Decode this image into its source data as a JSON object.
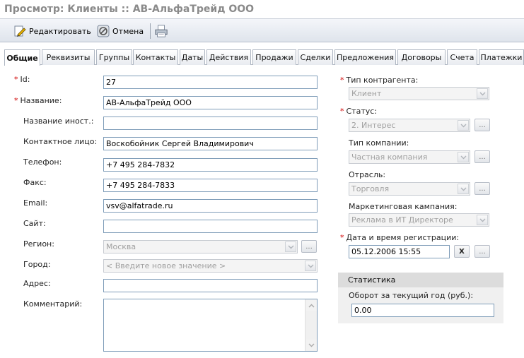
{
  "window": {
    "title": "Просмотр: Клиенты :: АВ-АльфаТрейд ООО"
  },
  "toolbar": {
    "edit_label": "Редактировать",
    "cancel_label": "Отмена"
  },
  "tabs": [
    "Общие",
    "Реквизиты",
    "Группы",
    "Контакты",
    "Даты",
    "Действия",
    "Продажи",
    "Сделки",
    "Предложения",
    "Договоры",
    "Счета",
    "Платежки"
  ],
  "form": {
    "id": {
      "label": "Id:",
      "value": "27",
      "required": true
    },
    "name": {
      "label": "Название:",
      "value": "АВ-АльфаТрейд ООО",
      "required": true
    },
    "foreign_name": {
      "label": "Название иност.:",
      "value": ""
    },
    "contact": {
      "label": "Контактное лицо:",
      "value": "Воскобойник Сергей Владимирович"
    },
    "phone": {
      "label": "Телефон:",
      "value": "+7 495 284-7832"
    },
    "fax": {
      "label": "Факс:",
      "value": "+7 495 284-7833"
    },
    "email": {
      "label": "Email:",
      "value": "vsv@alfatrade.ru"
    },
    "site": {
      "label": "Сайт:",
      "value": ""
    },
    "region": {
      "label": "Регион:",
      "value": "Москва"
    },
    "city": {
      "label": "Город:",
      "value": "< Введите новое значение >"
    },
    "address": {
      "label": "Адрес:",
      "value": ""
    },
    "comment": {
      "label": "Комментарий:",
      "value": ""
    }
  },
  "right": {
    "contractor_type": {
      "label": "Тип контрагента:",
      "value": "Клиент",
      "required": true
    },
    "status": {
      "label": "Статус:",
      "value": "2. Интерес",
      "required": true
    },
    "company_type": {
      "label": "Тип компании:",
      "value": "Частная компания"
    },
    "industry": {
      "label": "Отрасль:",
      "value": "Торговля"
    },
    "campaign": {
      "label": "Маркетинговая кампания:",
      "value": "Реклама в ИТ Директоре"
    },
    "reg_date": {
      "label": "Дата и время регистрации:",
      "value": "05.12.2006 15:55",
      "required": true
    }
  },
  "statistics": {
    "title": "Статистика",
    "turnover_label": "Оборот за текущий год (руб.):",
    "turnover_value": "0.00"
  },
  "common": {
    "required_mark": "*",
    "dots": "...",
    "clear_symbol": "X"
  },
  "colors": {
    "required": "#d00000",
    "accent_border": "#7f9db9"
  }
}
